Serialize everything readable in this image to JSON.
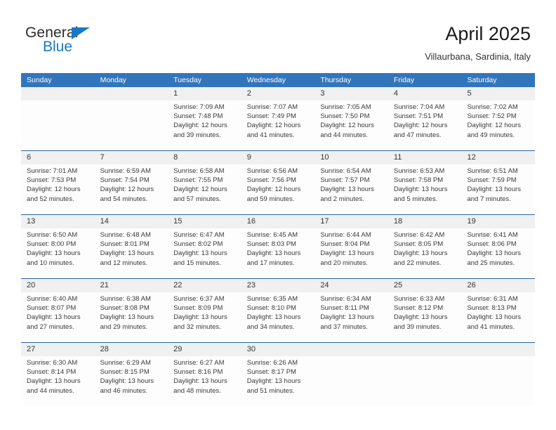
{
  "brand": {
    "name_part1": "General",
    "name_part2": "Blue",
    "triangle_icon": "triangle-icon",
    "color_dark": "#2b2b2b",
    "color_blue": "#1878c4"
  },
  "header": {
    "title": "April 2025",
    "subtitle": "Villaurbana, Sardinia, Italy"
  },
  "theme": {
    "header_blue": "#3275bb",
    "separator_blue": "#2466a5",
    "number_band": "#f0f0f0",
    "cell_background": "#fdfdfd",
    "text": "#3a3a3a"
  },
  "weekdays": [
    "Sunday",
    "Monday",
    "Tuesday",
    "Wednesday",
    "Thursday",
    "Friday",
    "Saturday"
  ],
  "weeks": [
    {
      "days": [
        {
          "number": "",
          "lines": [
            "",
            "",
            "",
            ""
          ]
        },
        {
          "number": "",
          "lines": [
            "",
            "",
            "",
            ""
          ]
        },
        {
          "number": "1",
          "lines": [
            "Sunrise: 7:09 AM",
            "Sunset: 7:48 PM",
            "Daylight: 12 hours",
            "and 39 minutes."
          ]
        },
        {
          "number": "2",
          "lines": [
            "Sunrise: 7:07 AM",
            "Sunset: 7:49 PM",
            "Daylight: 12 hours",
            "and 41 minutes."
          ]
        },
        {
          "number": "3",
          "lines": [
            "Sunrise: 7:05 AM",
            "Sunset: 7:50 PM",
            "Daylight: 12 hours",
            "and 44 minutes."
          ]
        },
        {
          "number": "4",
          "lines": [
            "Sunrise: 7:04 AM",
            "Sunset: 7:51 PM",
            "Daylight: 12 hours",
            "and 47 minutes."
          ]
        },
        {
          "number": "5",
          "lines": [
            "Sunrise: 7:02 AM",
            "Sunset: 7:52 PM",
            "Daylight: 12 hours",
            "and 49 minutes."
          ]
        }
      ]
    },
    {
      "days": [
        {
          "number": "6",
          "lines": [
            "Sunrise: 7:01 AM",
            "Sunset: 7:53 PM",
            "Daylight: 12 hours",
            "and 52 minutes."
          ]
        },
        {
          "number": "7",
          "lines": [
            "Sunrise: 6:59 AM",
            "Sunset: 7:54 PM",
            "Daylight: 12 hours",
            "and 54 minutes."
          ]
        },
        {
          "number": "8",
          "lines": [
            "Sunrise: 6:58 AM",
            "Sunset: 7:55 PM",
            "Daylight: 12 hours",
            "and 57 minutes."
          ]
        },
        {
          "number": "9",
          "lines": [
            "Sunrise: 6:56 AM",
            "Sunset: 7:56 PM",
            "Daylight: 12 hours",
            "and 59 minutes."
          ]
        },
        {
          "number": "10",
          "lines": [
            "Sunrise: 6:54 AM",
            "Sunset: 7:57 PM",
            "Daylight: 13 hours",
            "and 2 minutes."
          ]
        },
        {
          "number": "11",
          "lines": [
            "Sunrise: 6:53 AM",
            "Sunset: 7:58 PM",
            "Daylight: 13 hours",
            "and 5 minutes."
          ]
        },
        {
          "number": "12",
          "lines": [
            "Sunrise: 6:51 AM",
            "Sunset: 7:59 PM",
            "Daylight: 13 hours",
            "and 7 minutes."
          ]
        }
      ]
    },
    {
      "days": [
        {
          "number": "13",
          "lines": [
            "Sunrise: 6:50 AM",
            "Sunset: 8:00 PM",
            "Daylight: 13 hours",
            "and 10 minutes."
          ]
        },
        {
          "number": "14",
          "lines": [
            "Sunrise: 6:48 AM",
            "Sunset: 8:01 PM",
            "Daylight: 13 hours",
            "and 12 minutes."
          ]
        },
        {
          "number": "15",
          "lines": [
            "Sunrise: 6:47 AM",
            "Sunset: 8:02 PM",
            "Daylight: 13 hours",
            "and 15 minutes."
          ]
        },
        {
          "number": "16",
          "lines": [
            "Sunrise: 6:45 AM",
            "Sunset: 8:03 PM",
            "Daylight: 13 hours",
            "and 17 minutes."
          ]
        },
        {
          "number": "17",
          "lines": [
            "Sunrise: 6:44 AM",
            "Sunset: 8:04 PM",
            "Daylight: 13 hours",
            "and 20 minutes."
          ]
        },
        {
          "number": "18",
          "lines": [
            "Sunrise: 6:42 AM",
            "Sunset: 8:05 PM",
            "Daylight: 13 hours",
            "and 22 minutes."
          ]
        },
        {
          "number": "19",
          "lines": [
            "Sunrise: 6:41 AM",
            "Sunset: 8:06 PM",
            "Daylight: 13 hours",
            "and 25 minutes."
          ]
        }
      ]
    },
    {
      "days": [
        {
          "number": "20",
          "lines": [
            "Sunrise: 6:40 AM",
            "Sunset: 8:07 PM",
            "Daylight: 13 hours",
            "and 27 minutes."
          ]
        },
        {
          "number": "21",
          "lines": [
            "Sunrise: 6:38 AM",
            "Sunset: 8:08 PM",
            "Daylight: 13 hours",
            "and 29 minutes."
          ]
        },
        {
          "number": "22",
          "lines": [
            "Sunrise: 6:37 AM",
            "Sunset: 8:09 PM",
            "Daylight: 13 hours",
            "and 32 minutes."
          ]
        },
        {
          "number": "23",
          "lines": [
            "Sunrise: 6:35 AM",
            "Sunset: 8:10 PM",
            "Daylight: 13 hours",
            "and 34 minutes."
          ]
        },
        {
          "number": "24",
          "lines": [
            "Sunrise: 6:34 AM",
            "Sunset: 8:11 PM",
            "Daylight: 13 hours",
            "and 37 minutes."
          ]
        },
        {
          "number": "25",
          "lines": [
            "Sunrise: 6:33 AM",
            "Sunset: 8:12 PM",
            "Daylight: 13 hours",
            "and 39 minutes."
          ]
        },
        {
          "number": "26",
          "lines": [
            "Sunrise: 6:31 AM",
            "Sunset: 8:13 PM",
            "Daylight: 13 hours",
            "and 41 minutes."
          ]
        }
      ]
    },
    {
      "days": [
        {
          "number": "27",
          "lines": [
            "Sunrise: 6:30 AM",
            "Sunset: 8:14 PM",
            "Daylight: 13 hours",
            "and 44 minutes."
          ]
        },
        {
          "number": "28",
          "lines": [
            "Sunrise: 6:29 AM",
            "Sunset: 8:15 PM",
            "Daylight: 13 hours",
            "and 46 minutes."
          ]
        },
        {
          "number": "29",
          "lines": [
            "Sunrise: 6:27 AM",
            "Sunset: 8:16 PM",
            "Daylight: 13 hours",
            "and 48 minutes."
          ]
        },
        {
          "number": "30",
          "lines": [
            "Sunrise: 6:26 AM",
            "Sunset: 8:17 PM",
            "Daylight: 13 hours",
            "and 51 minutes."
          ]
        },
        {
          "number": "",
          "lines": [
            "",
            "",
            "",
            ""
          ]
        },
        {
          "number": "",
          "lines": [
            "",
            "",
            "",
            ""
          ]
        },
        {
          "number": "",
          "lines": [
            "",
            "",
            "",
            ""
          ]
        }
      ]
    }
  ]
}
